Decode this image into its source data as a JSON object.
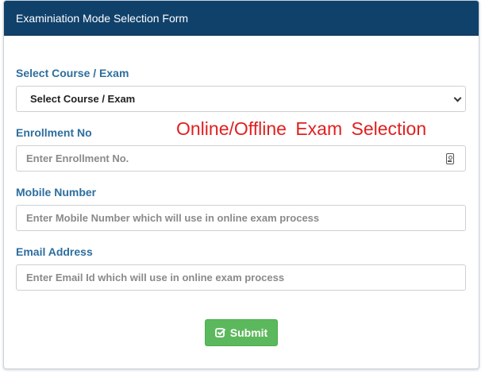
{
  "header": {
    "title": "Examiniation Mode Selection Form"
  },
  "form": {
    "course": {
      "label": "Select Course / Exam",
      "selected": "Select Course / Exam"
    },
    "enrollment": {
      "label": "Enrollment No",
      "placeholder": "Enter Enrollment No."
    },
    "mobile": {
      "label": "Mobile Number",
      "placeholder": "Enter Mobile Number which will use in online exam process"
    },
    "email": {
      "label": "Email Address",
      "placeholder": "Enter Email Id which will use in online exam process"
    },
    "submit_label": "Submit"
  },
  "annotation": {
    "text": "Online/Offline Exam Selection"
  },
  "colors": {
    "header_bg": "#10416b",
    "label": "#2d6e9e",
    "annotation": "#e02020",
    "submit_bg": "#5cb85c"
  },
  "icons": {
    "select_chevron": "chevron-down-icon",
    "enrollment_field": "id-card-icon",
    "submit": "check-square-icon"
  }
}
